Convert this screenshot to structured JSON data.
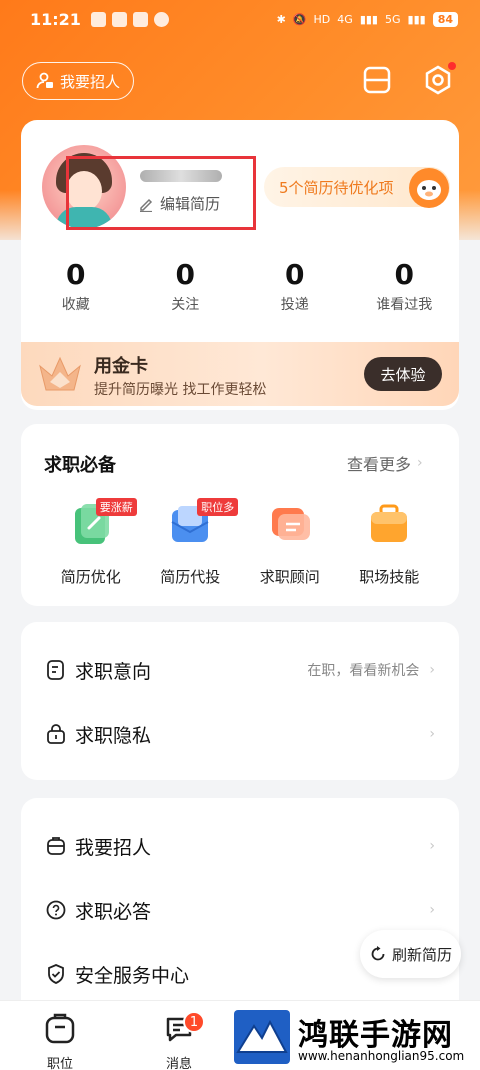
{
  "status_bar": {
    "time": "11:21",
    "network_labels": [
      "HD",
      "4G",
      "5G"
    ],
    "battery": "84"
  },
  "header": {
    "recruit_label": "我要招人"
  },
  "profile": {
    "edit_resume_label": "编辑简历",
    "optimize_pill": "5个简历待优化项",
    "stats": [
      {
        "value": "0",
        "label": "收藏"
      },
      {
        "value": "0",
        "label": "关注"
      },
      {
        "value": "0",
        "label": "投递"
      },
      {
        "value": "0",
        "label": "谁看过我"
      }
    ]
  },
  "gold_card": {
    "title": "用金卡",
    "subtitle": "提升简历曝光 找工作更轻松",
    "button": "去体验"
  },
  "job_prep": {
    "title": "求职必备",
    "more": "查看更多",
    "tools": [
      {
        "label": "简历优化",
        "badge": "要涨薪",
        "icon": "resume-optimize-icon"
      },
      {
        "label": "简历代投",
        "badge": "职位多",
        "icon": "resume-delivery-icon"
      },
      {
        "label": "求职顾问",
        "badge": "",
        "icon": "consultant-icon"
      },
      {
        "label": "职场技能",
        "badge": "",
        "icon": "skills-briefcase-icon"
      }
    ]
  },
  "intent_menu": [
    {
      "label": "求职意向",
      "value": "在职，看看新机会",
      "icon": "intent-icon"
    },
    {
      "label": "求职隐私",
      "value": "",
      "icon": "privacy-lock-icon"
    }
  ],
  "service_menu": [
    {
      "label": "我要招人",
      "icon": "recruit-bag-icon"
    },
    {
      "label": "求职必答",
      "icon": "question-icon"
    },
    {
      "label": "安全服务中心",
      "icon": "shield-icon"
    }
  ],
  "refresh_button": "刷新简历",
  "tabbar": [
    {
      "label": "职位",
      "icon": "jobs-icon",
      "badge": ""
    },
    {
      "label": "消息",
      "icon": "messages-icon",
      "badge": "1"
    }
  ],
  "watermark": {
    "title": "鸿联手游网",
    "url": "www.henanhonglian95.com"
  },
  "colors": {
    "brand_orange": "#ff7a1a",
    "badge_red": "#ee3b3b",
    "highlight_box": "#e8343a"
  }
}
